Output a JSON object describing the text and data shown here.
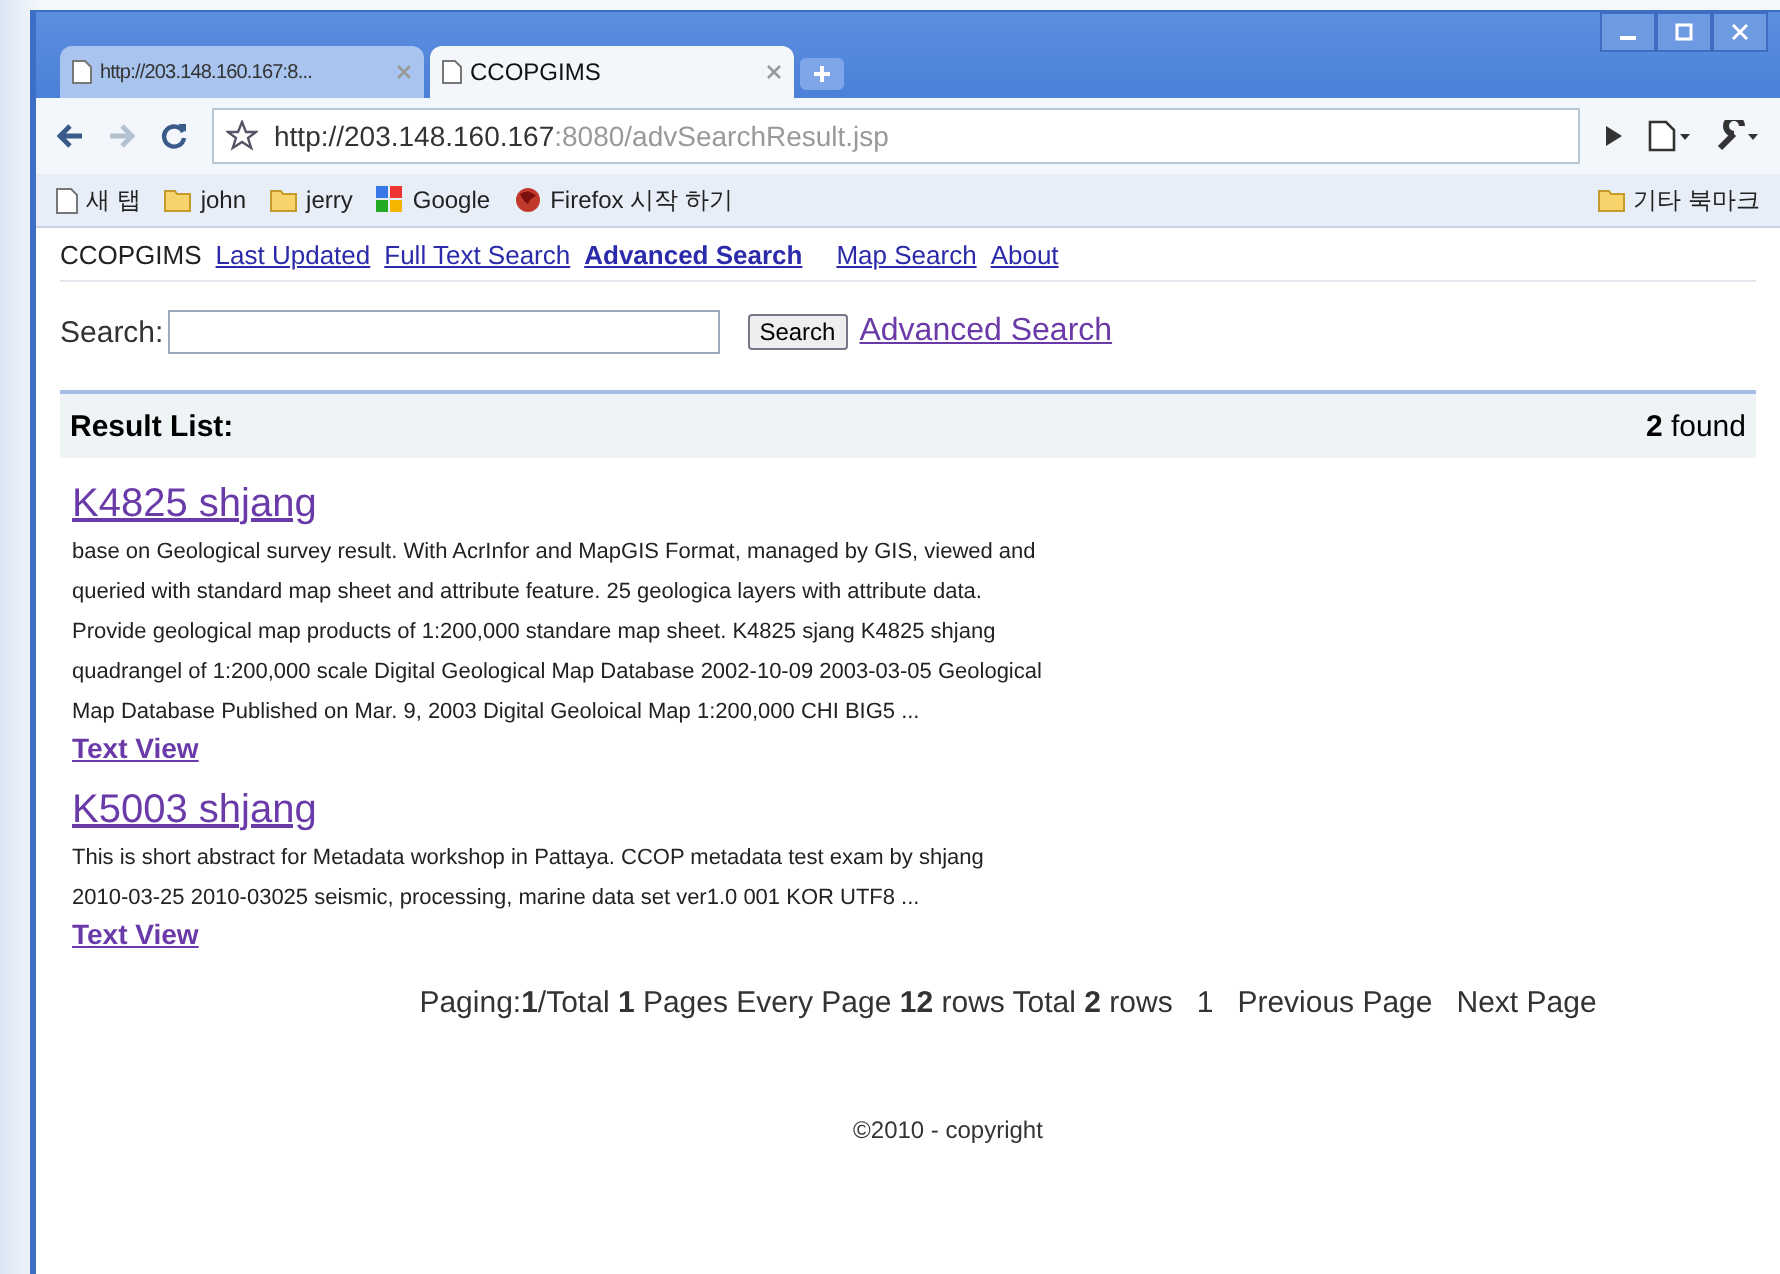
{
  "window": {
    "kind": "browser"
  },
  "tabs": [
    {
      "title": "http://203.148.160.167:8...",
      "selected": false
    },
    {
      "title": "CCOPGIMS",
      "selected": true
    }
  ],
  "address_bar": {
    "host": "http://203.148.160.167",
    "rest": ":8080/advSearchResult.jsp"
  },
  "bookmarks": [
    {
      "label": "새 탭",
      "kind": "page"
    },
    {
      "label": "john",
      "kind": "folder"
    },
    {
      "label": "jerry",
      "kind": "folder"
    },
    {
      "label": "Google",
      "kind": "google"
    },
    {
      "label": "Firefox 시작 하기",
      "kind": "firefox"
    }
  ],
  "other_bookmarks": "기타 북마크",
  "nav": {
    "site": "CCOPGIMS",
    "links": [
      {
        "label": "Last Updated",
        "selected": false
      },
      {
        "label": "Full Text Search",
        "selected": false
      },
      {
        "label": "Advanced Search",
        "selected": true
      },
      {
        "label": "Map Search",
        "selected": false
      },
      {
        "label": "About",
        "selected": false
      }
    ]
  },
  "search": {
    "label": "Search:",
    "button": "Search",
    "link": "Advanced Search"
  },
  "results": {
    "title": "Result List:",
    "count": "**2** found",
    "items": [
      {
        "title": "K4825 shjang",
        "lines": [
          "base on Geological survey result. With AcrInfor and MapGIS Format, managed by GIS, viewed and",
          "queried with standard map sheet and attribute feature. 25 geologica layers with attribute data.",
          "Provide geological map products of 1:200,000 standare map sheet. K4825 sjang K4825 shjang",
          "quadrangel of 1:200,000 scale Digital Geological Map Database 2002-10-09 2003-03-05 Geological",
          "Map Database Published on Mar. 9, 2003 Digital Geoloical Map 1:200,000 CHI BIG5 ..."
        ],
        "link": "Text View"
      },
      {
        "title": "K5003 shjang",
        "lines": [
          "This is short abstract for Metadata workshop in Pattaya. CCOP metadata test exam by shjang",
          "2010-03-25 2010-03025 seismic, processing, marine data set ver1.0 001 KOR UTF8 ..."
        ],
        "link": "Text View"
      }
    ]
  },
  "paging": {
    "summary": "Paging:**1**/Total **1** Pages Every Page **12** rows Total **2** rows",
    "page": "1",
    "previous": "Previous Page",
    "next": "Next Page"
  },
  "footer": "©2010 - copyright"
}
